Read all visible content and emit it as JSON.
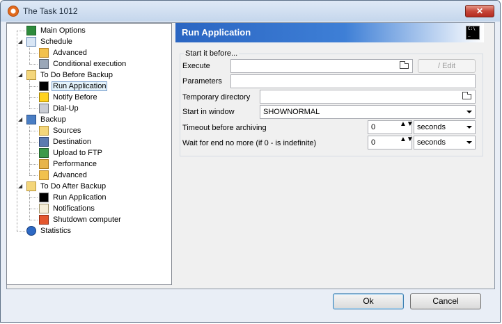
{
  "window": {
    "title": "The Task 1012",
    "close_glyph": "✕"
  },
  "tree": {
    "items": [
      {
        "label": "Main Options",
        "icon": "id-icon",
        "level": 0,
        "expander": ""
      },
      {
        "label": "Schedule",
        "icon": "schedule-icon",
        "level": 0,
        "expander": "◢"
      },
      {
        "label": "Advanced",
        "icon": "advanced-icon",
        "level": 1,
        "expander": ""
      },
      {
        "label": "Conditional execution",
        "icon": "filter-icon",
        "level": 1,
        "expander": ""
      },
      {
        "label": "To Do Before Backup",
        "icon": "folder-open-icon",
        "level": 0,
        "expander": "◢"
      },
      {
        "label": "Run Application",
        "icon": "console-icon",
        "level": 1,
        "expander": "",
        "selected": true
      },
      {
        "label": "Notify Before",
        "icon": "warning-icon",
        "level": 1,
        "expander": ""
      },
      {
        "label": "Dial-Up",
        "icon": "dialup-icon",
        "level": 1,
        "expander": ""
      },
      {
        "label": "Backup",
        "icon": "backup-icon",
        "level": 0,
        "expander": "◢"
      },
      {
        "label": "Sources",
        "icon": "folder-icon",
        "level": 1,
        "expander": ""
      },
      {
        "label": "Destination",
        "icon": "disk-icon",
        "level": 1,
        "expander": ""
      },
      {
        "label": "Upload to FTP",
        "icon": "ftp-icon",
        "level": 1,
        "expander": ""
      },
      {
        "label": "Performance",
        "icon": "performance-icon",
        "level": 1,
        "expander": ""
      },
      {
        "label": "Advanced",
        "icon": "advanced-icon",
        "level": 1,
        "expander": ""
      },
      {
        "label": "To Do After Backup",
        "icon": "folder-open-icon",
        "level": 0,
        "expander": "◢"
      },
      {
        "label": "Run Application",
        "icon": "console-icon",
        "level": 1,
        "expander": ""
      },
      {
        "label": "Notifications",
        "icon": "mail-icon",
        "level": 1,
        "expander": ""
      },
      {
        "label": "Shutdown computer",
        "icon": "shutdown-icon",
        "level": 1,
        "expander": ""
      },
      {
        "label": "Statistics",
        "icon": "info-icon",
        "level": 0,
        "expander": ""
      }
    ]
  },
  "panel": {
    "title": "Run Application",
    "group_title": "Start it before...",
    "execute_label": "Execute",
    "execute_value": "",
    "edit_button": "/ Edit",
    "parameters_label": "Parameters",
    "parameters_value": "",
    "tempdir_label": "Temporary directory",
    "tempdir_value": "",
    "start_window_label": "Start in window",
    "start_window_value": "SHOWNORMAL",
    "timeout_label": "Timeout before archiving",
    "timeout_value": "0",
    "timeout_unit": "seconds",
    "wait_label": "Wait for end no more (if 0 - is indefinite)",
    "wait_value": "0",
    "wait_unit": "seconds",
    "spin_glyph": "▲▼"
  },
  "footer": {
    "ok": "Ok",
    "cancel": "Cancel"
  },
  "colors": {
    "header_blue": "#2a65c2",
    "selection": "#e5f3fb",
    "close_red": "#c6473a"
  }
}
